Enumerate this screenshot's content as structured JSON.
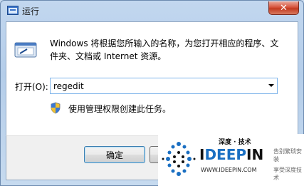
{
  "window": {
    "title": "运行",
    "close_glyph": "✕"
  },
  "dialog": {
    "description": "Windows 将根据您所输入的名称，为您打开相应的程序、文件夹、文档或 Internet 资源。",
    "open_label": "打开(O):",
    "open_value": "regedit",
    "admin_note": "使用管理权限创建此任务。",
    "ok_label": "确定",
    "cancel_label": ""
  },
  "watermark": {
    "top_text": "深度 · 技术",
    "brand_prefix": "I",
    "brand_mid": "DEEP",
    "brand_suffix": "IN",
    "url": "WWW.IDEEPIN.COM",
    "side_line1": "告别繁琐安装",
    "side_line2": "享受深度技术"
  },
  "icons": {
    "title_icon": "run-app-icon",
    "run_icon": "run-program-icon",
    "shield_icon": "uac-shield-icon",
    "dropdown_icon": "chevron-down-icon"
  }
}
